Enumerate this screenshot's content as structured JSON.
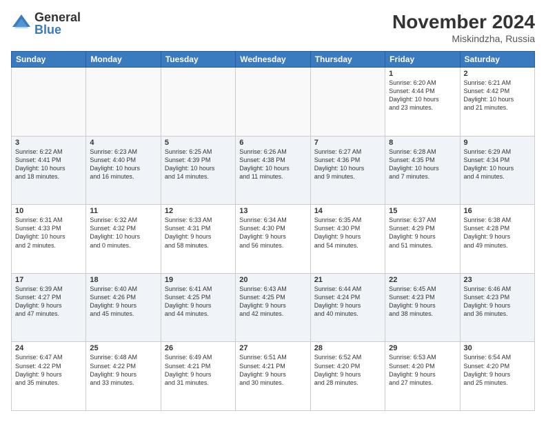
{
  "logo": {
    "general": "General",
    "blue": "Blue"
  },
  "title": "November 2024",
  "location": "Miskindzha, Russia",
  "days_of_week": [
    "Sunday",
    "Monday",
    "Tuesday",
    "Wednesday",
    "Thursday",
    "Friday",
    "Saturday"
  ],
  "weeks": [
    [
      {
        "day": "",
        "empty": true,
        "lines": []
      },
      {
        "day": "",
        "empty": true,
        "lines": []
      },
      {
        "day": "",
        "empty": true,
        "lines": []
      },
      {
        "day": "",
        "empty": true,
        "lines": []
      },
      {
        "day": "",
        "empty": true,
        "lines": []
      },
      {
        "day": "1",
        "empty": false,
        "lines": [
          "Sunrise: 6:20 AM",
          "Sunset: 4:44 PM",
          "Daylight: 10 hours",
          "and 23 minutes."
        ]
      },
      {
        "day": "2",
        "empty": false,
        "lines": [
          "Sunrise: 6:21 AM",
          "Sunset: 4:42 PM",
          "Daylight: 10 hours",
          "and 21 minutes."
        ]
      }
    ],
    [
      {
        "day": "3",
        "empty": false,
        "lines": [
          "Sunrise: 6:22 AM",
          "Sunset: 4:41 PM",
          "Daylight: 10 hours",
          "and 18 minutes."
        ]
      },
      {
        "day": "4",
        "empty": false,
        "lines": [
          "Sunrise: 6:23 AM",
          "Sunset: 4:40 PM",
          "Daylight: 10 hours",
          "and 16 minutes."
        ]
      },
      {
        "day": "5",
        "empty": false,
        "lines": [
          "Sunrise: 6:25 AM",
          "Sunset: 4:39 PM",
          "Daylight: 10 hours",
          "and 14 minutes."
        ]
      },
      {
        "day": "6",
        "empty": false,
        "lines": [
          "Sunrise: 6:26 AM",
          "Sunset: 4:38 PM",
          "Daylight: 10 hours",
          "and 11 minutes."
        ]
      },
      {
        "day": "7",
        "empty": false,
        "lines": [
          "Sunrise: 6:27 AM",
          "Sunset: 4:36 PM",
          "Daylight: 10 hours",
          "and 9 minutes."
        ]
      },
      {
        "day": "8",
        "empty": false,
        "lines": [
          "Sunrise: 6:28 AM",
          "Sunset: 4:35 PM",
          "Daylight: 10 hours",
          "and 7 minutes."
        ]
      },
      {
        "day": "9",
        "empty": false,
        "lines": [
          "Sunrise: 6:29 AM",
          "Sunset: 4:34 PM",
          "Daylight: 10 hours",
          "and 4 minutes."
        ]
      }
    ],
    [
      {
        "day": "10",
        "empty": false,
        "lines": [
          "Sunrise: 6:31 AM",
          "Sunset: 4:33 PM",
          "Daylight: 10 hours",
          "and 2 minutes."
        ]
      },
      {
        "day": "11",
        "empty": false,
        "lines": [
          "Sunrise: 6:32 AM",
          "Sunset: 4:32 PM",
          "Daylight: 10 hours",
          "and 0 minutes."
        ]
      },
      {
        "day": "12",
        "empty": false,
        "lines": [
          "Sunrise: 6:33 AM",
          "Sunset: 4:31 PM",
          "Daylight: 9 hours",
          "and 58 minutes."
        ]
      },
      {
        "day": "13",
        "empty": false,
        "lines": [
          "Sunrise: 6:34 AM",
          "Sunset: 4:30 PM",
          "Daylight: 9 hours",
          "and 56 minutes."
        ]
      },
      {
        "day": "14",
        "empty": false,
        "lines": [
          "Sunrise: 6:35 AM",
          "Sunset: 4:30 PM",
          "Daylight: 9 hours",
          "and 54 minutes."
        ]
      },
      {
        "day": "15",
        "empty": false,
        "lines": [
          "Sunrise: 6:37 AM",
          "Sunset: 4:29 PM",
          "Daylight: 9 hours",
          "and 51 minutes."
        ]
      },
      {
        "day": "16",
        "empty": false,
        "lines": [
          "Sunrise: 6:38 AM",
          "Sunset: 4:28 PM",
          "Daylight: 9 hours",
          "and 49 minutes."
        ]
      }
    ],
    [
      {
        "day": "17",
        "empty": false,
        "lines": [
          "Sunrise: 6:39 AM",
          "Sunset: 4:27 PM",
          "Daylight: 9 hours",
          "and 47 minutes."
        ]
      },
      {
        "day": "18",
        "empty": false,
        "lines": [
          "Sunrise: 6:40 AM",
          "Sunset: 4:26 PM",
          "Daylight: 9 hours",
          "and 45 minutes."
        ]
      },
      {
        "day": "19",
        "empty": false,
        "lines": [
          "Sunrise: 6:41 AM",
          "Sunset: 4:25 PM",
          "Daylight: 9 hours",
          "and 44 minutes."
        ]
      },
      {
        "day": "20",
        "empty": false,
        "lines": [
          "Sunrise: 6:43 AM",
          "Sunset: 4:25 PM",
          "Daylight: 9 hours",
          "and 42 minutes."
        ]
      },
      {
        "day": "21",
        "empty": false,
        "lines": [
          "Sunrise: 6:44 AM",
          "Sunset: 4:24 PM",
          "Daylight: 9 hours",
          "and 40 minutes."
        ]
      },
      {
        "day": "22",
        "empty": false,
        "lines": [
          "Sunrise: 6:45 AM",
          "Sunset: 4:23 PM",
          "Daylight: 9 hours",
          "and 38 minutes."
        ]
      },
      {
        "day": "23",
        "empty": false,
        "lines": [
          "Sunrise: 6:46 AM",
          "Sunset: 4:23 PM",
          "Daylight: 9 hours",
          "and 36 minutes."
        ]
      }
    ],
    [
      {
        "day": "24",
        "empty": false,
        "lines": [
          "Sunrise: 6:47 AM",
          "Sunset: 4:22 PM",
          "Daylight: 9 hours",
          "and 35 minutes."
        ]
      },
      {
        "day": "25",
        "empty": false,
        "lines": [
          "Sunrise: 6:48 AM",
          "Sunset: 4:22 PM",
          "Daylight: 9 hours",
          "and 33 minutes."
        ]
      },
      {
        "day": "26",
        "empty": false,
        "lines": [
          "Sunrise: 6:49 AM",
          "Sunset: 4:21 PM",
          "Daylight: 9 hours",
          "and 31 minutes."
        ]
      },
      {
        "day": "27",
        "empty": false,
        "lines": [
          "Sunrise: 6:51 AM",
          "Sunset: 4:21 PM",
          "Daylight: 9 hours",
          "and 30 minutes."
        ]
      },
      {
        "day": "28",
        "empty": false,
        "lines": [
          "Sunrise: 6:52 AM",
          "Sunset: 4:20 PM",
          "Daylight: 9 hours",
          "and 28 minutes."
        ]
      },
      {
        "day": "29",
        "empty": false,
        "lines": [
          "Sunrise: 6:53 AM",
          "Sunset: 4:20 PM",
          "Daylight: 9 hours",
          "and 27 minutes."
        ]
      },
      {
        "day": "30",
        "empty": false,
        "lines": [
          "Sunrise: 6:54 AM",
          "Sunset: 4:20 PM",
          "Daylight: 9 hours",
          "and 25 minutes."
        ]
      }
    ]
  ]
}
